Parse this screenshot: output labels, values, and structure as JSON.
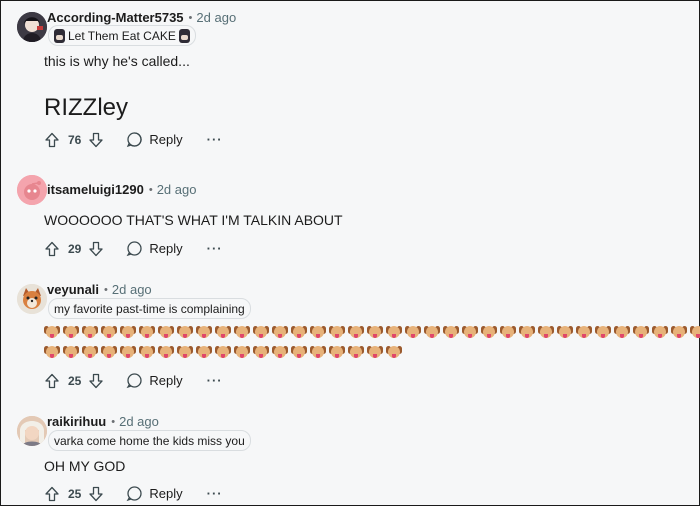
{
  "comments": [
    {
      "username": "According-Matter5735",
      "time": "2d ago",
      "flair": "Let Them Eat CAKE",
      "text": "this is why he's called...",
      "text2": "RIZZley",
      "votes": "76",
      "reply_label": "Reply",
      "more": "···"
    },
    {
      "username": "itsameluigi1290",
      "time": "2d ago",
      "text": "WOOOOOO THAT'S WHAT I'M TALKIN ABOUT",
      "votes": "29",
      "reply_label": "Reply",
      "more": "···"
    },
    {
      "username": "veyunali",
      "time": "2d ago",
      "flair": "my favorite past-time is complaining",
      "emoji_row1_count": 35,
      "emoji_row2_count": 19,
      "votes": "25",
      "reply_label": "Reply",
      "more": "···"
    },
    {
      "username": "raikirihuu",
      "time": "2d ago",
      "flair": "varka come home the kids miss you",
      "text": "OH MY GOD",
      "votes": "25",
      "reply_label": "Reply",
      "more": "···"
    }
  ],
  "separator": "•",
  "icons": [
    "upvote-icon",
    "downvote-icon",
    "reply-icon",
    "more-icon"
  ],
  "colors": {
    "background": "#f6f7f8",
    "meta": "#576f76",
    "text": "#1c1c1c"
  }
}
